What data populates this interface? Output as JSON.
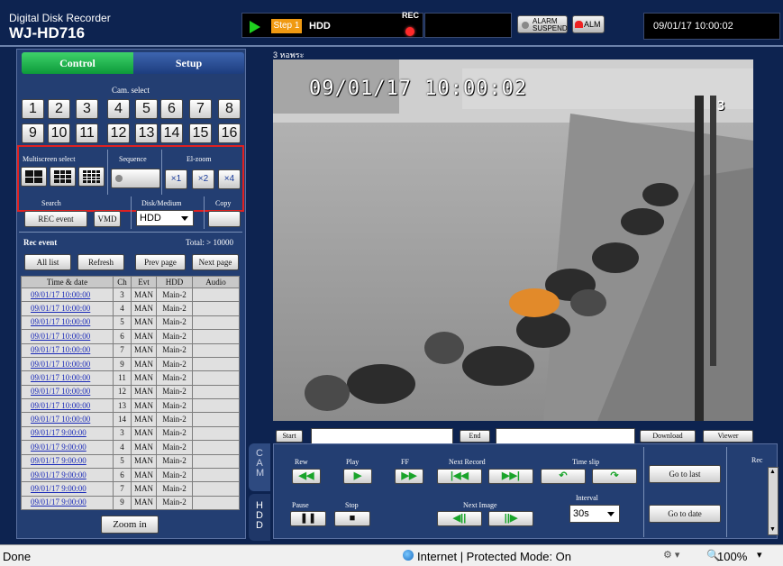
{
  "header": {
    "app_title": "Digital Disk Recorder",
    "model": "WJ-HD716",
    "step_badge": "Step 1",
    "mode": "HDD",
    "rec_label": "REC",
    "alarm_suspend_line1": "ALARM",
    "alarm_suspend_line2": "SUSPEND",
    "alm_label": "ALM",
    "datetime": "09/01/17  10:00:02"
  },
  "tabs": {
    "control": "Control",
    "setup": "Setup"
  },
  "cam_select": {
    "label": "Cam. select",
    "row1": [
      "1",
      "2",
      "3",
      "4",
      "5",
      "6",
      "7",
      "8"
    ],
    "row2": [
      "9",
      "10",
      "11",
      "12",
      "13",
      "14",
      "15",
      "16"
    ]
  },
  "multiscreen": {
    "label": "Multiscreen select",
    "sequence_label": "Sequence",
    "ezoom_label": "El-zoom",
    "zoom_buttons": [
      "×1",
      "×2",
      "×4"
    ]
  },
  "search": {
    "search_label": "Search",
    "disk_label": "Disk/Medium",
    "copy_label": "Copy",
    "rec_event_btn": "REC event",
    "vmd_btn": "VMD",
    "disk_value": "HDD"
  },
  "rec_event": {
    "title": "Rec event",
    "total": "Total: > 10000",
    "buttons": [
      "All list",
      "Refresh",
      "Prev page",
      "Next page"
    ],
    "columns": [
      "Time & date",
      "Ch",
      "Evt",
      "HDD",
      "Audio"
    ],
    "rows": [
      [
        "09/01/17  10:00:00",
        "3",
        "MAN",
        "Main-2",
        ""
      ],
      [
        "09/01/17  10:00:00",
        "4",
        "MAN",
        "Main-2",
        ""
      ],
      [
        "09/01/17  10:00:00",
        "5",
        "MAN",
        "Main-2",
        ""
      ],
      [
        "09/01/17  10:00:00",
        "6",
        "MAN",
        "Main-2",
        ""
      ],
      [
        "09/01/17  10:00:00",
        "7",
        "MAN",
        "Main-2",
        ""
      ],
      [
        "09/01/17  10:00:00",
        "9",
        "MAN",
        "Main-2",
        ""
      ],
      [
        "09/01/17  10:00:00",
        "11",
        "MAN",
        "Main-2",
        ""
      ],
      [
        "09/01/17  10:00:00",
        "12",
        "MAN",
        "Main-2",
        ""
      ],
      [
        "09/01/17  10:00:00",
        "13",
        "MAN",
        "Main-2",
        ""
      ],
      [
        "09/01/17  10:00:00",
        "14",
        "MAN",
        "Main-2",
        ""
      ],
      [
        "09/01/17   9:00:00",
        "3",
        "MAN",
        "Main-2",
        ""
      ],
      [
        "09/01/17   9:00:00",
        "4",
        "MAN",
        "Main-2",
        ""
      ],
      [
        "09/01/17   9:00:00",
        "5",
        "MAN",
        "Main-2",
        ""
      ],
      [
        "09/01/17   9:00:00",
        "6",
        "MAN",
        "Main-2",
        ""
      ],
      [
        "09/01/17   9:00:00",
        "7",
        "MAN",
        "Main-2",
        ""
      ],
      [
        "09/01/17   9:00:00",
        "9",
        "MAN",
        "Main-2",
        ""
      ]
    ],
    "zoom_in": "Zoom in"
  },
  "video": {
    "channel_label": "3 หอพระ",
    "osd_datetime": "09/01/17  10:00:02",
    "osd_channel": "3"
  },
  "download_bar": {
    "start": "Start",
    "end": "End",
    "download": "Download",
    "viewer": "Viewer"
  },
  "playback": {
    "cam_tab": "CAM",
    "hdd_tab": "HDD",
    "rew": "Rew",
    "play": "Play",
    "ff": "FF",
    "next_record": "Next Record",
    "time_slip": "Time slip",
    "pause": "Pause",
    "stop": "Stop",
    "next_image": "Next Image",
    "interval_label": "Interval",
    "interval_value": "30s",
    "go_to_last": "Go to last",
    "go_to_date": "Go to date",
    "rec_label": "Rec"
  },
  "statusbar": {
    "left": "Done",
    "zone": "Internet | Protected Mode: On",
    "zoom": "100%"
  }
}
